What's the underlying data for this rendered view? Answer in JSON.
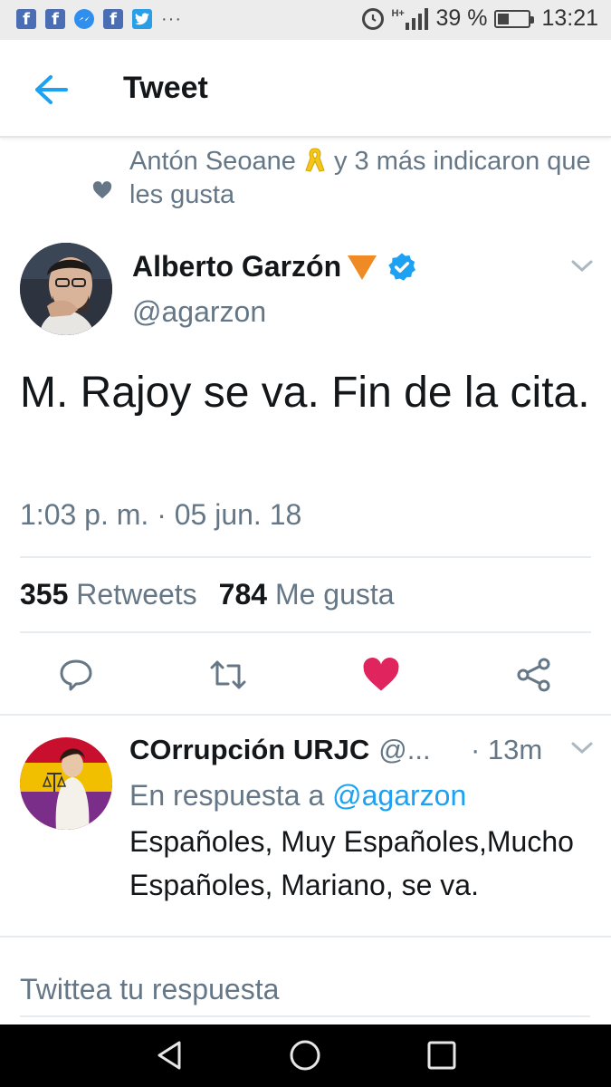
{
  "status_bar": {
    "battery_text": "39 %",
    "battery_level": 0.39,
    "time": "13:21",
    "network_label": "H+",
    "app_icons": [
      "facebook-icon",
      "facebook-icon",
      "messenger-icon",
      "facebook-icon",
      "twitter-icon"
    ],
    "overflow": "···"
  },
  "header": {
    "title": "Tweet",
    "back_icon": "arrow-left-icon"
  },
  "context": {
    "text_before": "Antón Seoane ",
    "text_after": " y 3 más indicaron que les gusta",
    "icon": "heart-icon"
  },
  "tweet": {
    "author_name": "Alberto Garzón",
    "author_handle": "@agarzon",
    "text": "M. Rajoy se va. Fin de la cita.",
    "timestamp": "1:03 p. m. · 05 jun. 18",
    "retweets_count": "355",
    "retweets_label": "Retweets",
    "likes_count": "784",
    "likes_label": "Me gusta",
    "verified": true,
    "liked": true
  },
  "reply": {
    "author_name": "COrrupción URJC",
    "author_handle": "@...",
    "time": "· 13m",
    "reply_prefix": "En respuesta a",
    "reply_to_handle": "@agarzon",
    "text": "Españoles, Muy Españoles,Mucho Españoles, Mariano, se va."
  },
  "compose": {
    "placeholder": "Twittea tu respuesta"
  },
  "colors": {
    "accent": "#1da1f2",
    "like": "#e0245e",
    "secondary_text": "#657786",
    "primary_text": "#14171a"
  }
}
